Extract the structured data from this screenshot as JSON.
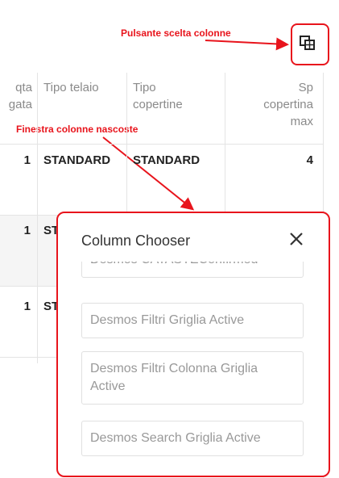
{
  "annotations": {
    "button_label": "Pulsante scelta colonne",
    "window_label": "Finestra colonne nascoste"
  },
  "colors": {
    "annotation": "#e8141c"
  },
  "toolbar": {
    "column_chooser_icon": "column-chooser-icon"
  },
  "grid": {
    "headers": [
      {
        "line1": "qta",
        "line2": "gata"
      },
      {
        "line1": "Tipo telaio",
        "line2": ""
      },
      {
        "line1": "Tipo",
        "line2": "copertine"
      },
      {
        "line1": "Sp",
        "line2": "copertina",
        "line3": "max"
      }
    ],
    "rows": [
      {
        "qta": "1",
        "telaio": "STANDARD",
        "copertine": "STANDARD",
        "sp": "4"
      },
      {
        "qta": "1",
        "telaio": "ST",
        "copertine": "",
        "sp": ""
      },
      {
        "qta": "1",
        "telaio": "ST",
        "copertine": "",
        "sp": ""
      }
    ]
  },
  "column_chooser": {
    "title": "Column Chooser",
    "close_icon": "close-icon",
    "items": [
      "Desmos CATASTEConfirmed",
      "Desmos Filtri Griglia Active",
      "Desmos Filtri Colonna Griglia Active",
      "Desmos Search Griglia Active"
    ]
  }
}
